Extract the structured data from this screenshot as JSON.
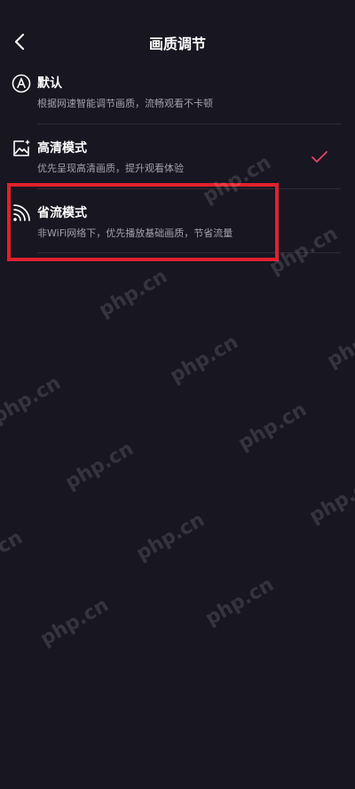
{
  "header": {
    "title": "画质调节",
    "back_icon": "chevron-left-icon"
  },
  "options": [
    {
      "id": "default",
      "title": "默认",
      "description": "根据网速智能调节画质，流畅观看不卡顿",
      "icon": "auto-a-icon",
      "selected": false
    },
    {
      "id": "hd",
      "title": "高清模式",
      "description": "优先呈现高清画质，提升观看体验",
      "icon": "hd-image-icon",
      "selected": true
    },
    {
      "id": "saver",
      "title": "省流模式",
      "description": "非WiFi网络下，优先播放基础画质，节省流量",
      "icon": "wifi-signal-icon",
      "selected": false
    }
  ],
  "watermark": "php.cn",
  "colors": {
    "background": "#171621",
    "check": "#e8456b",
    "highlight": "#e0202e",
    "secondary_text": "#a3a2ab"
  }
}
